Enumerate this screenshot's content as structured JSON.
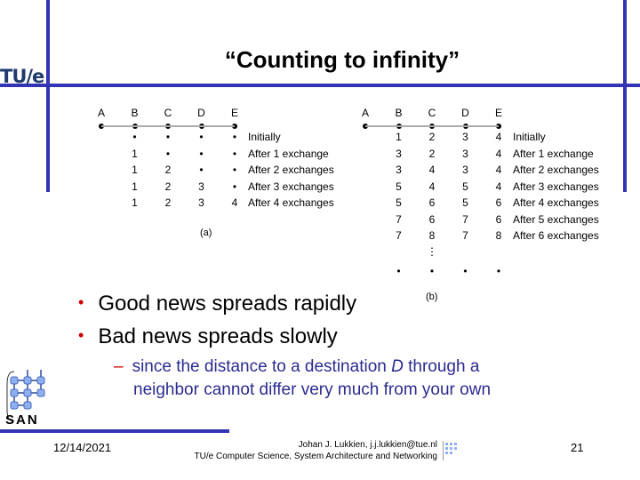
{
  "header": {
    "logo": "TU/e",
    "title": "“Counting to infinity”"
  },
  "figure_a": {
    "nodes": [
      "A",
      "B",
      "C",
      "D",
      "E"
    ],
    "rows": [
      {
        "values": [
          "•",
          "•",
          "•",
          "•"
        ],
        "label": "Initially"
      },
      {
        "values": [
          "1",
          "•",
          "•",
          "•"
        ],
        "label": "After 1 exchange"
      },
      {
        "values": [
          "1",
          "2",
          "•",
          "•"
        ],
        "label": "After 2 exchanges"
      },
      {
        "values": [
          "1",
          "2",
          "3",
          "•"
        ],
        "label": "After 3 exchanges"
      },
      {
        "values": [
          "1",
          "2",
          "3",
          "4"
        ],
        "label": "After 4 exchanges"
      }
    ],
    "caption": "(a)"
  },
  "figure_b": {
    "nodes": [
      "A",
      "B",
      "C",
      "D",
      "E"
    ],
    "rows": [
      {
        "values": [
          "1",
          "2",
          "3",
          "4"
        ],
        "label": "Initially"
      },
      {
        "values": [
          "3",
          "2",
          "3",
          "4"
        ],
        "label": "After 1 exchange"
      },
      {
        "values": [
          "3",
          "4",
          "3",
          "4"
        ],
        "label": "After 2 exchanges"
      },
      {
        "values": [
          "5",
          "4",
          "5",
          "4"
        ],
        "label": "After 3 exchanges"
      },
      {
        "values": [
          "5",
          "6",
          "5",
          "6"
        ],
        "label": "After 4 exchanges"
      },
      {
        "values": [
          "7",
          "6",
          "7",
          "6"
        ],
        "label": "After 5 exchanges"
      },
      {
        "values": [
          "7",
          "8",
          "7",
          "8"
        ],
        "label": "After 6 exchanges"
      }
    ],
    "ellipsis": "⋮",
    "final_row": [
      "•",
      "•",
      "•",
      "•"
    ],
    "caption": "(b)"
  },
  "bullets": [
    "Good news spreads rapidly",
    "Bad news spreads slowly"
  ],
  "sub_bullet": {
    "line1_pre": "since the distance to a destination ",
    "line1_em": "D",
    "line1_post": " through a",
    "line2": "neighbor cannot differ very much from your own"
  },
  "logos": {
    "san": "SAN"
  },
  "footer": {
    "date": "12/14/2021",
    "author": "Johan J. Lukkien, j.j.lukkien@tue.nl",
    "affiliation": "TU/e Computer Science, System Architecture and Networking",
    "page": "21"
  },
  "colors": {
    "accent_bar": "#3333b3",
    "bullet": "#cc0000",
    "sub_text": "#2b2b8f"
  }
}
